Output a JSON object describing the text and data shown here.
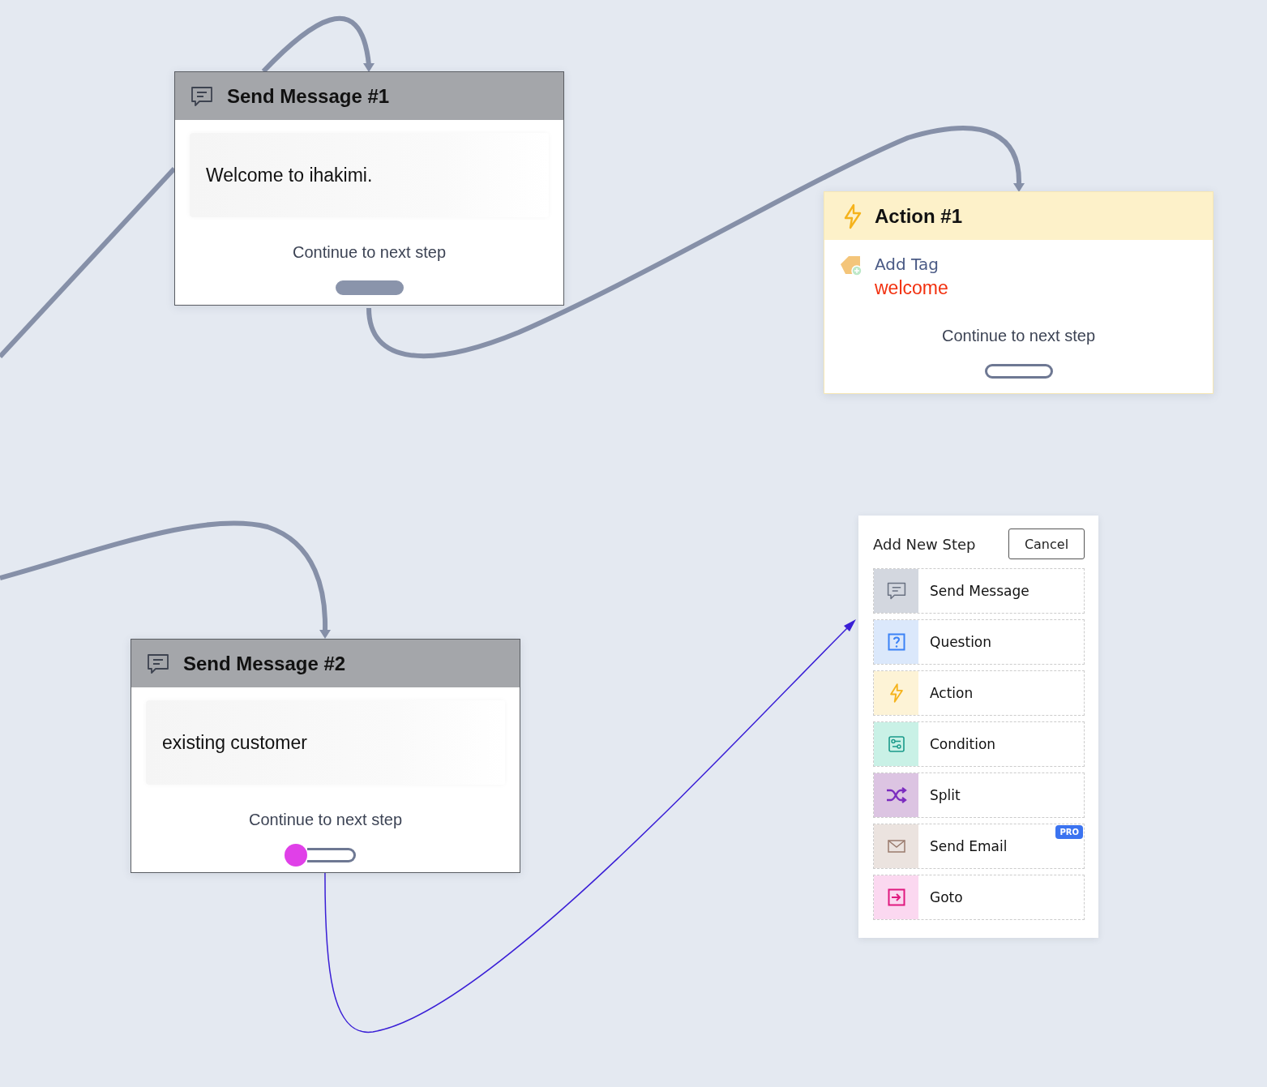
{
  "canvas": {
    "nodes": [
      {
        "kind": "message",
        "title": "Send Message #1",
        "message": "Welcome to ihakimi.",
        "continue_label": "Continue to next step",
        "port_connected": true,
        "port_dragging": false
      },
      {
        "kind": "action",
        "title": "Action #1",
        "action": "Add Tag",
        "tag": "welcome",
        "continue_label": "Continue to next step",
        "port_connected": false,
        "port_dragging": false
      },
      {
        "kind": "message",
        "title": "Send Message #2",
        "message": "existing customer",
        "continue_label": "Continue to next step",
        "port_connected": false,
        "port_dragging": true
      }
    ]
  },
  "add_step_panel": {
    "title": "Add New Step",
    "cancel": "Cancel",
    "options": [
      {
        "kind": "message",
        "label": "Send Message",
        "color": "#d3d7df"
      },
      {
        "kind": "question",
        "label": "Question",
        "color": "#dbe8fb"
      },
      {
        "kind": "action",
        "label": "Action",
        "color": "#fdf3d6"
      },
      {
        "kind": "condition",
        "label": "Condition",
        "color": "#c9f1e6"
      },
      {
        "kind": "split",
        "label": "Split",
        "color": "#dcc4e2"
      },
      {
        "kind": "email",
        "label": "Send Email",
        "color": "#ebe3df",
        "badge": "PRO"
      },
      {
        "kind": "goto",
        "label": "Goto",
        "color": "#fbd8f0"
      }
    ]
  }
}
